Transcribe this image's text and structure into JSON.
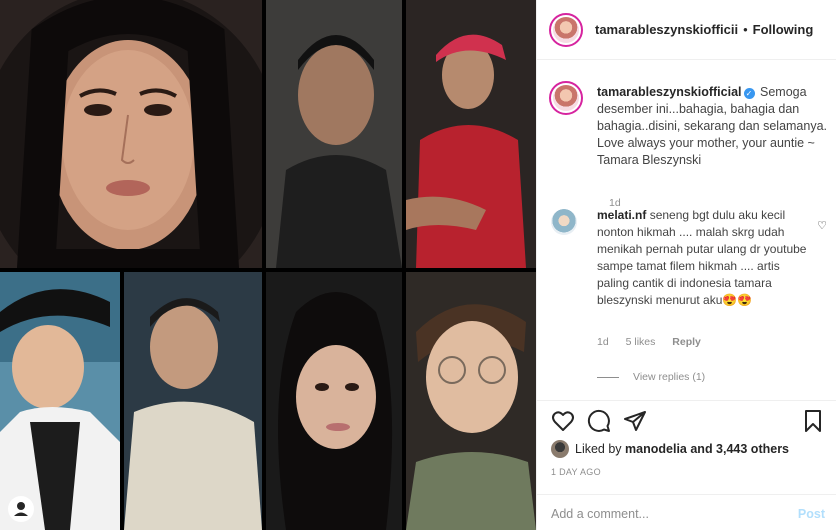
{
  "header": {
    "username": "tamarableszynskiofficial",
    "username_display": "tamarableszynskiofficii",
    "separator": "•",
    "follow_status": "Following"
  },
  "caption": {
    "username": "tamarableszynskiofficial",
    "text": "Semoga desember ini...bahagia, bahagia dan bahagia..disini, sekarang dan selamanya. Love always your mother, your auntie ~ Tamara Bleszynski",
    "time": "1d"
  },
  "comment": {
    "username": "melati.nf",
    "text": "seneng bgt dulu aku kecil nonton hikmah .... malah skrg udah menikah pernah putar ulang dr youtube sampe tamat filem hikmah .... artis paling cantik di indonesia tamara bleszynski menurut aku😍😍",
    "time": "1d",
    "likes": "5 likes",
    "reply_label": "Reply",
    "view_replies": "View replies (1)"
  },
  "icons": {
    "like": "heart-icon",
    "comment": "comment-icon",
    "share": "share-icon",
    "save": "bookmark-icon",
    "verified": "verified-badge-icon"
  },
  "likes": {
    "prefix": "Liked by",
    "user": "manodelia",
    "suffix": "and 3,443 others"
  },
  "time_ago": "1 DAY AGO",
  "add_comment": {
    "placeholder": "Add a comment...",
    "post_label": "Post"
  },
  "colors": {
    "link_blue": "#3897f0",
    "post_disabled": "#b2dffc",
    "muted": "#8e8e8e",
    "text": "#262626"
  }
}
